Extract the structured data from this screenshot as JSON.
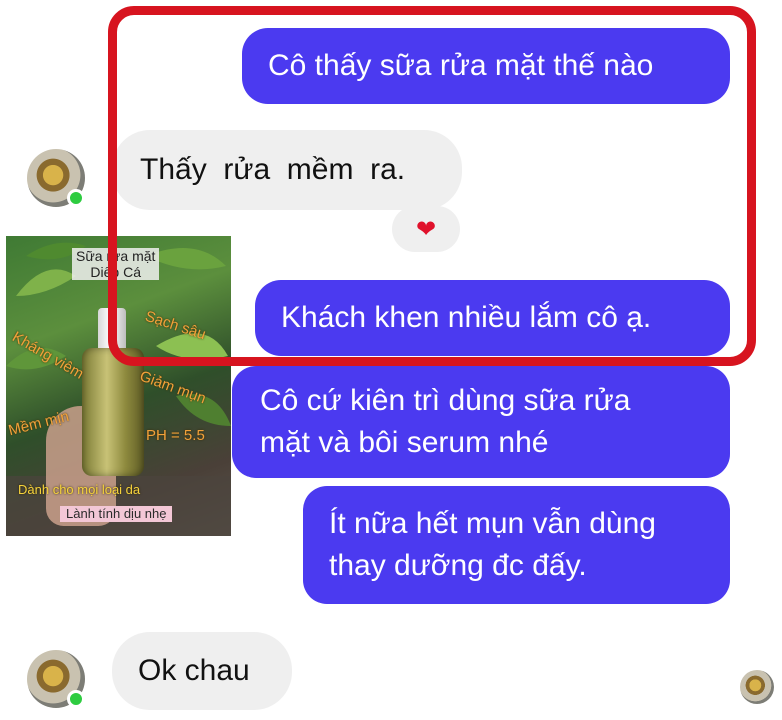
{
  "messages": {
    "m1": "Cô thấy sữa rửa mặt thế nào",
    "m2": "Thấy  rửa  mềm  ra.",
    "m3": "Khách khen nhiều lắm cô ạ.",
    "m4_line1": "Cô cứ kiên trì dùng sữa rửa",
    "m4_line2": "mặt và bôi serum nhé",
    "m5_line1": "Ít nữa hết mụn vẫn dùng",
    "m5_line2": "thay dưỡng đc đấy.",
    "m6": "Ok chau"
  },
  "reaction": {
    "icon": "heart-icon",
    "glyph": "❤"
  },
  "product_image": {
    "title_line1": "Sữa rửa mặt",
    "title_line2": "Diếp Cá",
    "tag_sach_sau": "Sạch sâu",
    "tag_khang_viem": "Kháng viêm",
    "tag_giam_mun": "Giảm mụn",
    "tag_mem_min": "Mềm mịn",
    "tag_ph": "PH = 5.5",
    "tag_danh_cho": "Dành cho mọi loại da",
    "tag_lanh_tinh": "Lành tính dịu nhẹ"
  },
  "colors": {
    "outgoing_bubble": "#4b3af0",
    "incoming_bubble": "#efefef",
    "highlight_border": "#d7141f",
    "online_dot": "#2ecc40"
  }
}
